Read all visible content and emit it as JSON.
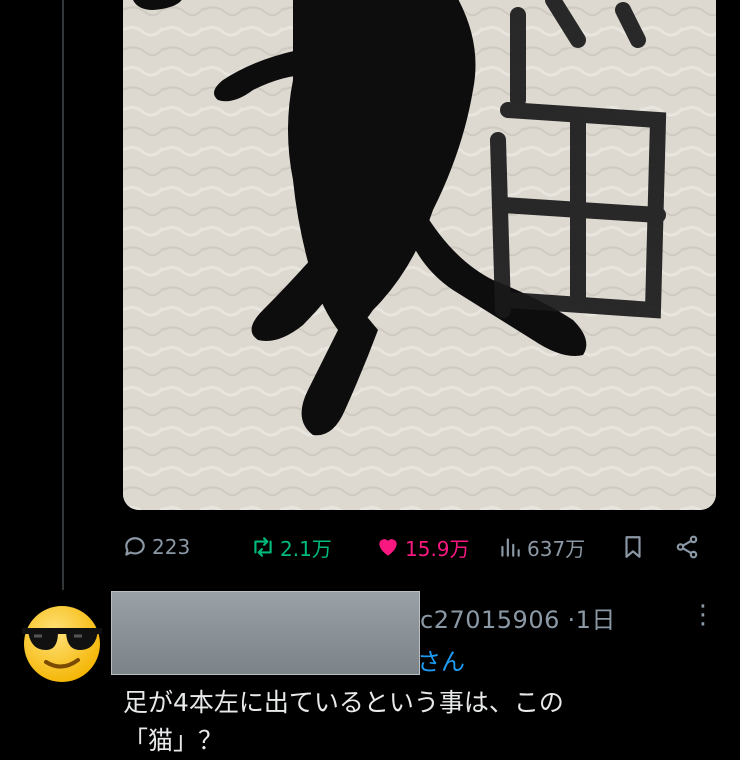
{
  "tweet": {
    "image_alt": "black-cat-photo-with-drawn-kanji",
    "stats": {
      "replies": "223",
      "reposts": "2.1万",
      "likes": "15.9万",
      "views": "637万"
    },
    "colors": {
      "repost": "#00ba7c",
      "like": "#f91880",
      "muted": "#8b98a5",
      "link": "#1d9bf0"
    }
  },
  "reply": {
    "handle_suffix": "c27015906",
    "separator": "·",
    "time": "1日",
    "reply_to_suffix": "さん",
    "text_line1": "足が4本左に出ているという事は、この",
    "text_line2": "「猫」？"
  }
}
